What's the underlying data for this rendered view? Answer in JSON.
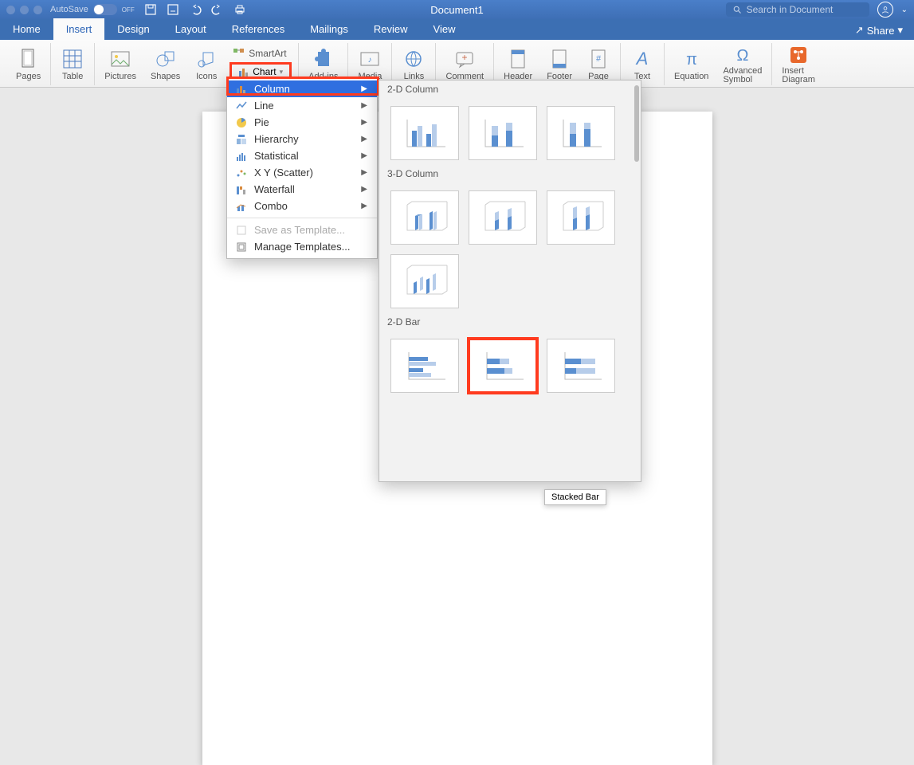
{
  "titlebar": {
    "autosave_label": "AutoSave",
    "autosave_toggle": "OFF",
    "document_title": "Document1",
    "search_placeholder": "Search in Document"
  },
  "tabs": [
    "Home",
    "Insert",
    "Design",
    "Layout",
    "References",
    "Mailings",
    "Review",
    "View"
  ],
  "active_tab_index": 1,
  "share_label": "Share",
  "ribbon": {
    "pages": "Pages",
    "table": "Table",
    "pictures": "Pictures",
    "shapes": "Shapes",
    "icons": "Icons",
    "smartart": "SmartArt",
    "chart": "Chart",
    "addins": "Add-ins",
    "media": "Media",
    "links": "Links",
    "comment": "Comment",
    "header": "Header",
    "footer": "Footer",
    "page": "Page",
    "text": "Text",
    "equation": "Equation",
    "adv_symbol_l1": "Advanced",
    "adv_symbol_l2": "Symbol",
    "insert_dia_l1": "Insert",
    "insert_dia_l2": "Diagram"
  },
  "chart_menu": {
    "items": [
      {
        "label": "Column",
        "key": "column"
      },
      {
        "label": "Line",
        "key": "line"
      },
      {
        "label": "Pie",
        "key": "pie"
      },
      {
        "label": "Hierarchy",
        "key": "hierarchy"
      },
      {
        "label": "Statistical",
        "key": "statistical"
      },
      {
        "label": "X Y (Scatter)",
        "key": "scatter"
      },
      {
        "label": "Waterfall",
        "key": "waterfall"
      },
      {
        "label": "Combo",
        "key": "combo"
      }
    ],
    "selected_index": 0,
    "save_template": "Save as Template...",
    "manage_templates": "Manage Templates..."
  },
  "gallery": {
    "sections": [
      {
        "title": "2-D Column",
        "tiles": [
          "clustered-column",
          "stacked-column",
          "100-stacked-column"
        ]
      },
      {
        "title": "3-D Column",
        "tiles": [
          "3d-clustered-column",
          "3d-stacked-column",
          "3d-100-stacked-column",
          "3d-column"
        ]
      },
      {
        "title": "2-D Bar",
        "tiles": [
          "clustered-bar",
          "stacked-bar",
          "100-stacked-bar"
        ]
      }
    ],
    "selected_tile": "stacked-bar"
  },
  "tooltip": "Stacked Bar"
}
